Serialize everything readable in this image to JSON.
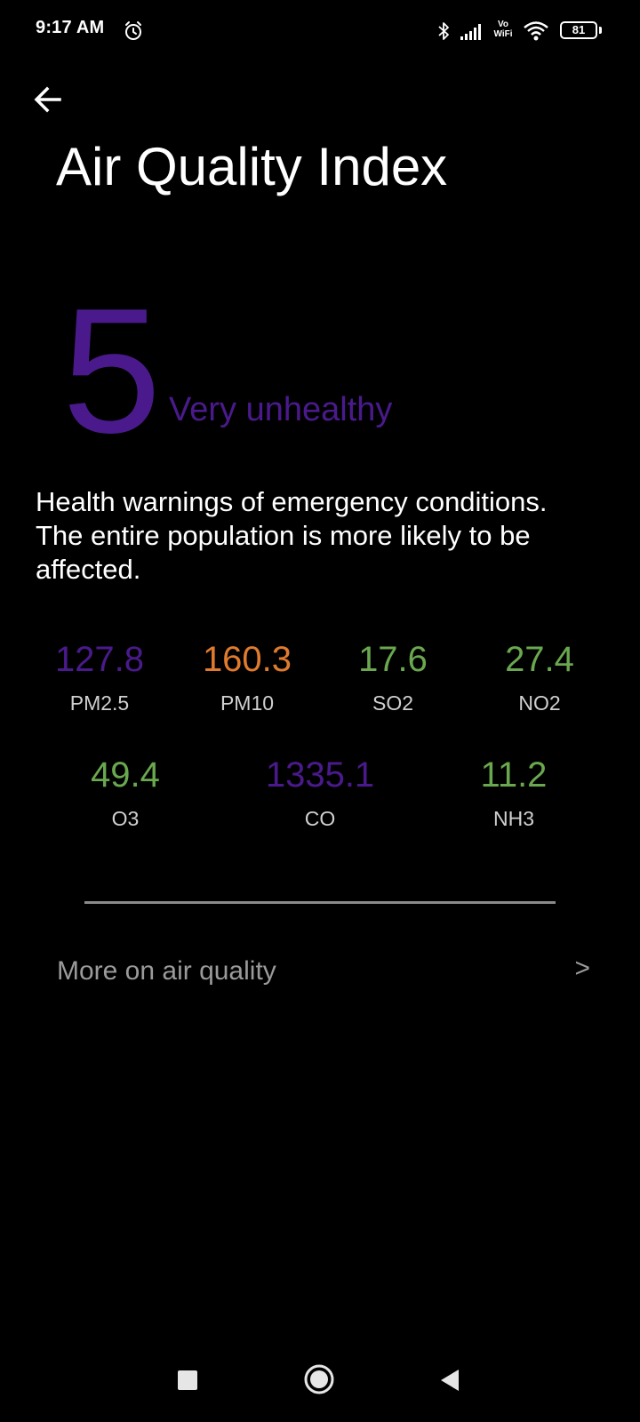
{
  "status_bar": {
    "time": "9:17 AM",
    "vowifi_top": "Vo",
    "vowifi_bottom": "WiFi",
    "battery": "81"
  },
  "header": {
    "title": "Air Quality Index"
  },
  "aqi": {
    "value": "5",
    "label": "Very unhealthy",
    "description": "Health warnings of emergency conditions. The entire population is more likely to be affected.",
    "color": "#4a1a8c"
  },
  "pollutants": [
    {
      "value": "127.8",
      "name": "PM2.5",
      "color": "#4a1a8c"
    },
    {
      "value": "160.3",
      "name": "PM10",
      "color": "#e07b2e"
    },
    {
      "value": "17.6",
      "name": "SO2",
      "color": "#6aa84f"
    },
    {
      "value": "27.4",
      "name": "NO2",
      "color": "#6aa84f"
    },
    {
      "value": "49.4",
      "name": "O3",
      "color": "#6aa84f"
    },
    {
      "value": "1335.1",
      "name": "CO",
      "color": "#4a1a8c"
    },
    {
      "value": "11.2",
      "name": "NH3",
      "color": "#6aa84f"
    }
  ],
  "more": {
    "label": "More on air quality",
    "chevron": ">"
  },
  "icons": {
    "back": "back-arrow-icon",
    "alarm": "alarm-icon",
    "bluetooth": "bluetooth-icon",
    "signal": "signal-icon",
    "wifi": "wifi-icon",
    "nav_recents": "recents-square-icon",
    "nav_home": "home-circle-icon",
    "nav_back": "back-triangle-icon"
  }
}
